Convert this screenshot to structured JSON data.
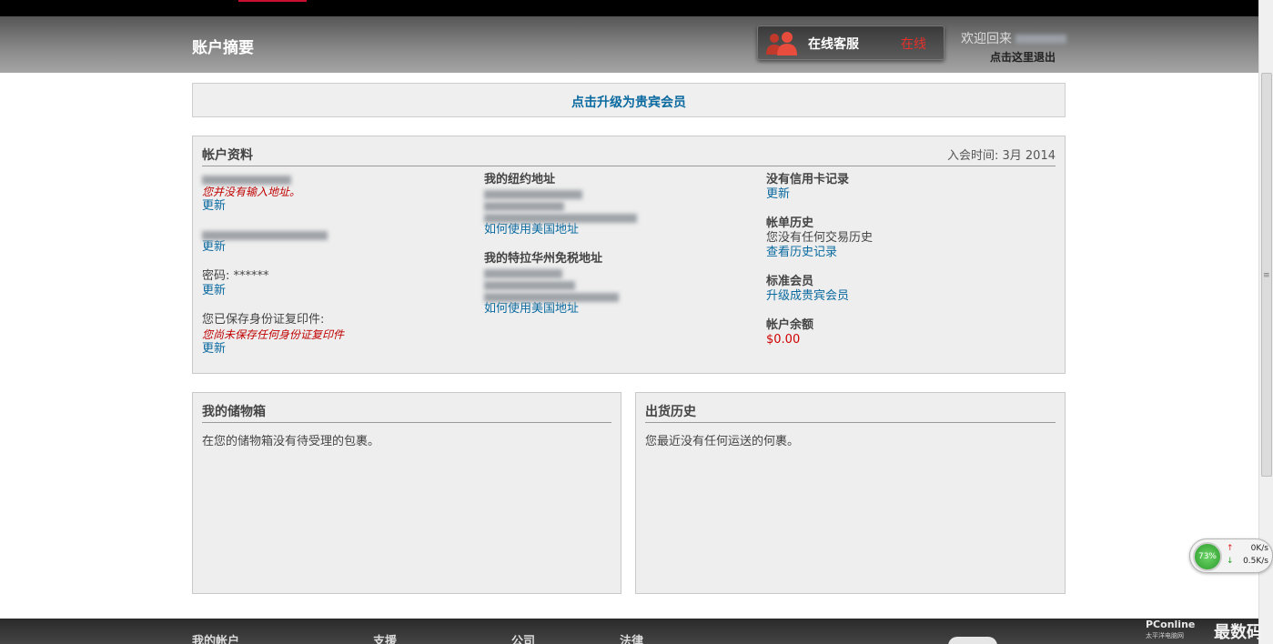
{
  "header": {
    "title": "账户摘要",
    "support_label": "在线客服",
    "support_status": "在线",
    "welcome": "欢迎回来",
    "logout": "点击这里退出"
  },
  "upgrade": {
    "label": "点击升级为贵宾会员"
  },
  "account": {
    "title": "帐户资料",
    "joined": "入会时间: 3月 2014",
    "col1": {
      "no_address": "您并没有输入地址。",
      "update": "更新",
      "password": "密码: ******",
      "id_saved_label": "您已保存身份证复印件:",
      "id_not_saved": "您尚未保存任何身份证复印件"
    },
    "col2": {
      "ny_title": "我的纽约地址",
      "how_to": "如何使用美国地址",
      "de_title": "我的特拉华州免税地址"
    },
    "col3": {
      "no_card": "没有信用卡记录",
      "update": "更新",
      "billing_title": "帐单历史",
      "no_history": "您没有任何交易历史",
      "view_history": "查看历史记录",
      "standard_member": "标准会员",
      "upgrade_vip": "升级成贵宾会员",
      "balance_title": "帐户余额",
      "balance": "$0.00"
    }
  },
  "storage": {
    "title": "我的储物箱",
    "empty": "在您的储物箱没有待受理的包裹。"
  },
  "shipping": {
    "title": "出货历史",
    "empty": "您最近没有任何运送的何裹。"
  },
  "footer": {
    "items": [
      "我的帐户",
      "支援",
      "公司",
      "法律"
    ]
  },
  "net_widget": {
    "percent": "73%",
    "up": "0K/s",
    "down": "0.5K/s"
  },
  "watermark": {
    "site": "PConline",
    "site_sub": "太平洋电脑网",
    "brand": "最数码"
  },
  "colors": {
    "link": "#0a6aa0",
    "warning": "#c00000",
    "status_online": "#e8302a"
  }
}
